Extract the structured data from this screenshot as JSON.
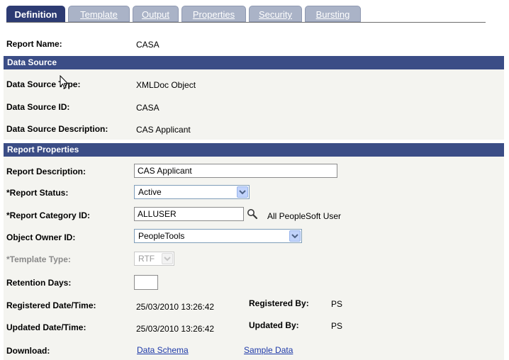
{
  "tabs": [
    {
      "label": "Definition",
      "active": true
    },
    {
      "label": "Template",
      "active": false
    },
    {
      "label": "Output",
      "active": false
    },
    {
      "label": "Properties",
      "active": false
    },
    {
      "label": "Security",
      "active": false
    },
    {
      "label": "Bursting",
      "active": false
    }
  ],
  "report_name": {
    "label": "Report Name:",
    "value": "CASA"
  },
  "data_source": {
    "header": "Data Source",
    "type_label": "Data Source Type:",
    "type_value": "XMLDoc Object",
    "id_label": "Data Source ID:",
    "id_value": "CASA",
    "desc_label": "Data Source Description:",
    "desc_value": "CAS Applicant"
  },
  "report_properties": {
    "header": "Report Properties",
    "description": {
      "label": "Report Description:",
      "value": "CAS Applicant"
    },
    "status": {
      "label": "*Report Status:",
      "value": "Active"
    },
    "category": {
      "label": "*Report Category ID:",
      "value": "ALLUSER",
      "description": "All PeopleSoft User"
    },
    "owner": {
      "label": "Object Owner ID:",
      "value": "PeopleTools"
    },
    "template_type": {
      "label": "*Template Type:",
      "value": "RTF"
    },
    "retention": {
      "label": "Retention Days:",
      "value": ""
    },
    "registered": {
      "label": "Registered Date/Time:",
      "value": "25/03/2010 13:26:42",
      "by_label": "Registered By:",
      "by_value": "PS"
    },
    "updated": {
      "label": "Updated Date/Time:",
      "value": "25/03/2010 13:26:42",
      "by_label": "Updated By:",
      "by_value": "PS"
    },
    "download": {
      "label": "Download:",
      "data_schema": "Data Schema",
      "sample_data": "Sample Data"
    }
  },
  "colors": {
    "tab_active": "#2d3b73",
    "tab_inactive": "#aab3c7",
    "section_header": "#3b4d86",
    "section_body": "#f4f4f0",
    "link": "#1d39a8"
  }
}
